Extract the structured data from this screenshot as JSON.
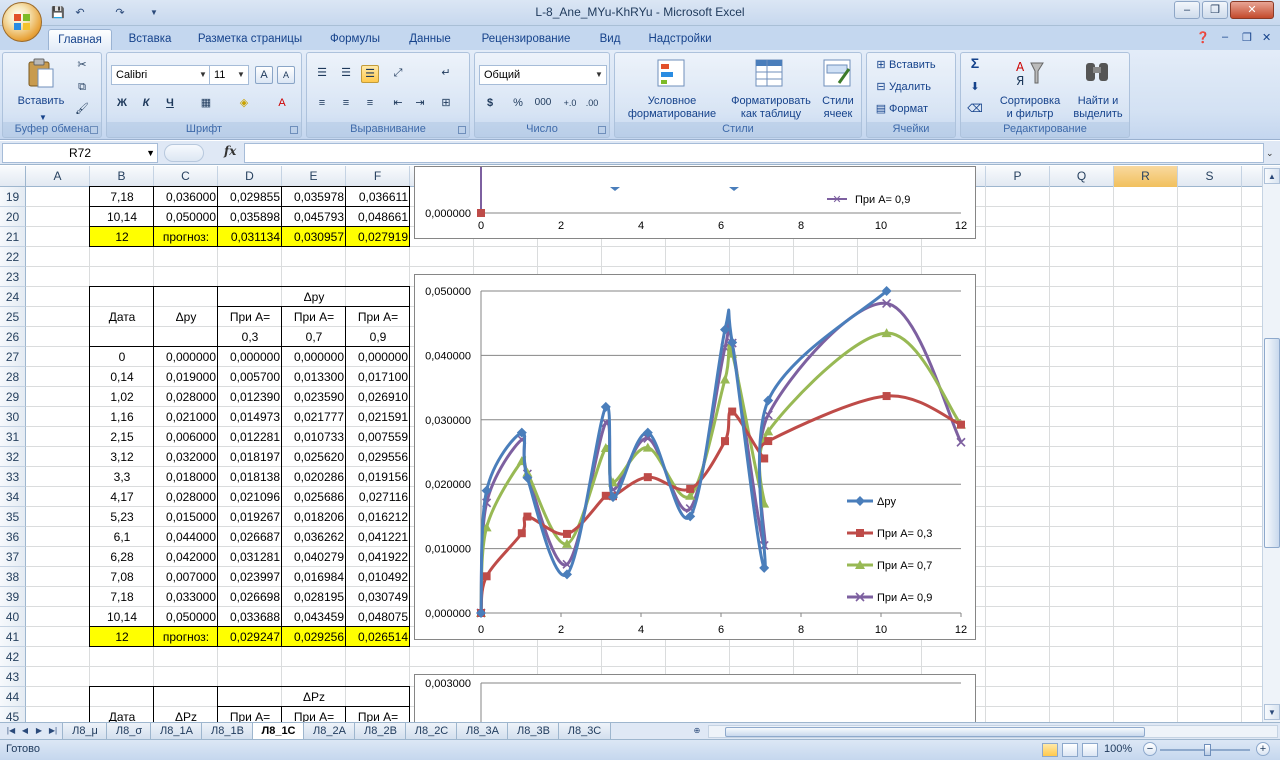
{
  "window": {
    "title": "L-8_Ane_MYu-KhRYu - Microsoft Excel",
    "controls": {
      "minimize": "–",
      "restore": "❐",
      "close": "✕"
    }
  },
  "tabs": [
    {
      "label": "Главная",
      "active": true
    },
    {
      "label": "Вставка"
    },
    {
      "label": "Разметка страницы"
    },
    {
      "label": "Формулы"
    },
    {
      "label": "Данные"
    },
    {
      "label": "Рецензирование"
    },
    {
      "label": "Вид"
    },
    {
      "label": "Надстройки"
    }
  ],
  "ribbon": {
    "clipboard": {
      "group": "Буфер обмена",
      "paste": "Вставить"
    },
    "font": {
      "group": "Шрифт",
      "name": "Calibri",
      "size": "11",
      "bold": "Ж",
      "italic": "К",
      "underline": "Ч"
    },
    "alignment": {
      "group": "Выравнивание"
    },
    "number": {
      "group": "Число",
      "format": "Общий",
      "currency": "$",
      "percent": "%",
      "thousands": "000"
    },
    "styles": {
      "group": "Стили",
      "conditional1": "Условное",
      "conditional2": "форматирование",
      "table1": "Форматировать",
      "table2": "как таблицу",
      "cell1": "Стили",
      "cell2": "ячеек"
    },
    "cells": {
      "group": "Ячейки",
      "insert": "Вставить",
      "delete": "Удалить",
      "format": "Формат"
    },
    "editing": {
      "group": "Редактирование",
      "sigma": "Σ",
      "sort1": "Сортировка",
      "sort2": "и фильтр",
      "find1": "Найти и",
      "find2": "выделить"
    }
  },
  "formula_bar": {
    "name_box": "R72",
    "fx": "fx",
    "formula": ""
  },
  "columns": [
    "A",
    "B",
    "C",
    "D",
    "E",
    "F",
    "G",
    "H",
    "I",
    "J",
    "K",
    "L",
    "M",
    "N",
    "O",
    "P",
    "Q",
    "R",
    "S"
  ],
  "selected_column": "R",
  "rows": [
    "19",
    "20",
    "21",
    "22",
    "23",
    "24",
    "25",
    "26",
    "27",
    "28",
    "29",
    "30",
    "31",
    "32",
    "33",
    "34",
    "35",
    "36",
    "37",
    "38",
    "39",
    "40",
    "41",
    "42",
    "43",
    "44",
    "45"
  ],
  "top_rows": [
    [
      "7,18",
      "0,036000",
      "0,029855",
      "0,035978",
      "0,036611"
    ],
    [
      "10,14",
      "0,050000",
      "0,035898",
      "0,045793",
      "0,048661"
    ]
  ],
  "top_forecast": [
    "12",
    "прогноз:",
    "0,031134",
    "0,030957",
    "0,027919"
  ],
  "table2": {
    "header_date": "Дата",
    "header_main": "Δpy",
    "group_label": "Δpy",
    "sub_top": [
      "При А=",
      "При А=",
      "При А="
    ],
    "sub_bottom": [
      "0,3",
      "0,7",
      "0,9"
    ],
    "rows": [
      [
        "0",
        "0,000000",
        "0,000000",
        "0,000000",
        "0,000000"
      ],
      [
        "0,14",
        "0,019000",
        "0,005700",
        "0,013300",
        "0,017100"
      ],
      [
        "1,02",
        "0,028000",
        "0,012390",
        "0,023590",
        "0,026910"
      ],
      [
        "1,16",
        "0,021000",
        "0,014973",
        "0,021777",
        "0,021591"
      ],
      [
        "2,15",
        "0,006000",
        "0,012281",
        "0,010733",
        "0,007559"
      ],
      [
        "3,12",
        "0,032000",
        "0,018197",
        "0,025620",
        "0,029556"
      ],
      [
        "3,3",
        "0,018000",
        "0,018138",
        "0,020286",
        "0,019156"
      ],
      [
        "4,17",
        "0,028000",
        "0,021096",
        "0,025686",
        "0,027116"
      ],
      [
        "5,23",
        "0,015000",
        "0,019267",
        "0,018206",
        "0,016212"
      ],
      [
        "6,1",
        "0,044000",
        "0,026687",
        "0,036262",
        "0,041221"
      ],
      [
        "6,28",
        "0,042000",
        "0,031281",
        "0,040279",
        "0,041922"
      ],
      [
        "7,08",
        "0,007000",
        "0,023997",
        "0,016984",
        "0,010492"
      ],
      [
        "7,18",
        "0,033000",
        "0,026698",
        "0,028195",
        "0,030749"
      ],
      [
        "10,14",
        "0,050000",
        "0,033688",
        "0,043459",
        "0,048075"
      ]
    ],
    "forecast": [
      "12",
      "прогноз:",
      "0,029247",
      "0,029256",
      "0,026514"
    ]
  },
  "table3": {
    "header_date": "Дата",
    "header_main": "ΔPz",
    "group_label": "ΔPz",
    "sub_top": [
      "При А=",
      "При А=",
      "При А="
    ]
  },
  "top_chart": {
    "y_tick": "0,000000",
    "x_ticks": [
      "0",
      "2",
      "4",
      "6",
      "8",
      "10",
      "12"
    ],
    "legend": "При А= 0,9"
  },
  "chart_data": [
    {
      "type": "line",
      "smoothed": true,
      "x": [
        0,
        0.14,
        1.02,
        1.16,
        2.15,
        3.12,
        3.3,
        4.17,
        5.23,
        6.1,
        6.28,
        7.08,
        7.18,
        10.14,
        12
      ],
      "xlim": [
        0,
        12
      ],
      "ylim": [
        0,
        0.05
      ],
      "x_ticks": [
        "0",
        "2",
        "4",
        "6",
        "8",
        "10",
        "12"
      ],
      "y_ticks": [
        "0,000000",
        "0,010000",
        "0,020000",
        "0,030000",
        "0,040000",
        "0,050000"
      ],
      "grid": true,
      "legend_position": "right",
      "series": [
        {
          "name": "Δpy",
          "color": "#4a7ebb",
          "marker": "diamond",
          "values": [
            0,
            0.019,
            0.028,
            0.021,
            0.006,
            0.032,
            0.018,
            0.028,
            0.015,
            0.044,
            0.042,
            0.007,
            0.033,
            0.05,
            null
          ]
        },
        {
          "name": "При А= 0,3",
          "color": "#be4b48",
          "marker": "square",
          "values": [
            0,
            0.0057,
            0.01239,
            0.014973,
            0.012281,
            0.018197,
            0.018138,
            0.021096,
            0.019267,
            0.026687,
            0.031281,
            0.023997,
            0.026698,
            0.033688,
            0.029247
          ]
        },
        {
          "name": "При А= 0,7",
          "color": "#98b954",
          "marker": "triangle",
          "values": [
            0,
            0.0133,
            0.02359,
            0.021777,
            0.010733,
            0.02562,
            0.020286,
            0.025686,
            0.018206,
            0.036262,
            0.040279,
            0.016984,
            0.028195,
            0.043459,
            0.029256
          ]
        },
        {
          "name": "При А= 0,9",
          "color": "#7d60a0",
          "marker": "x",
          "values": [
            0,
            0.0171,
            0.02691,
            0.021591,
            0.007559,
            0.029556,
            0.019156,
            0.027116,
            0.016212,
            0.041221,
            0.041922,
            0.010492,
            0.030749,
            0.048075,
            0.026514
          ]
        }
      ]
    }
  ],
  "bottom_chart": {
    "y_tick": "0,003000"
  },
  "sheets": [
    "Л8_μ",
    "Л8_σ",
    "Л8_1A",
    "Л8_1B",
    "Л8_1C",
    "Л8_2A",
    "Л8_2B",
    "Л8_2C",
    "Л8_3A",
    "Л8_3B",
    "Л8_3C"
  ],
  "active_sheet": "Л8_1C",
  "status": {
    "ready": "Готово",
    "zoom": "100%"
  }
}
